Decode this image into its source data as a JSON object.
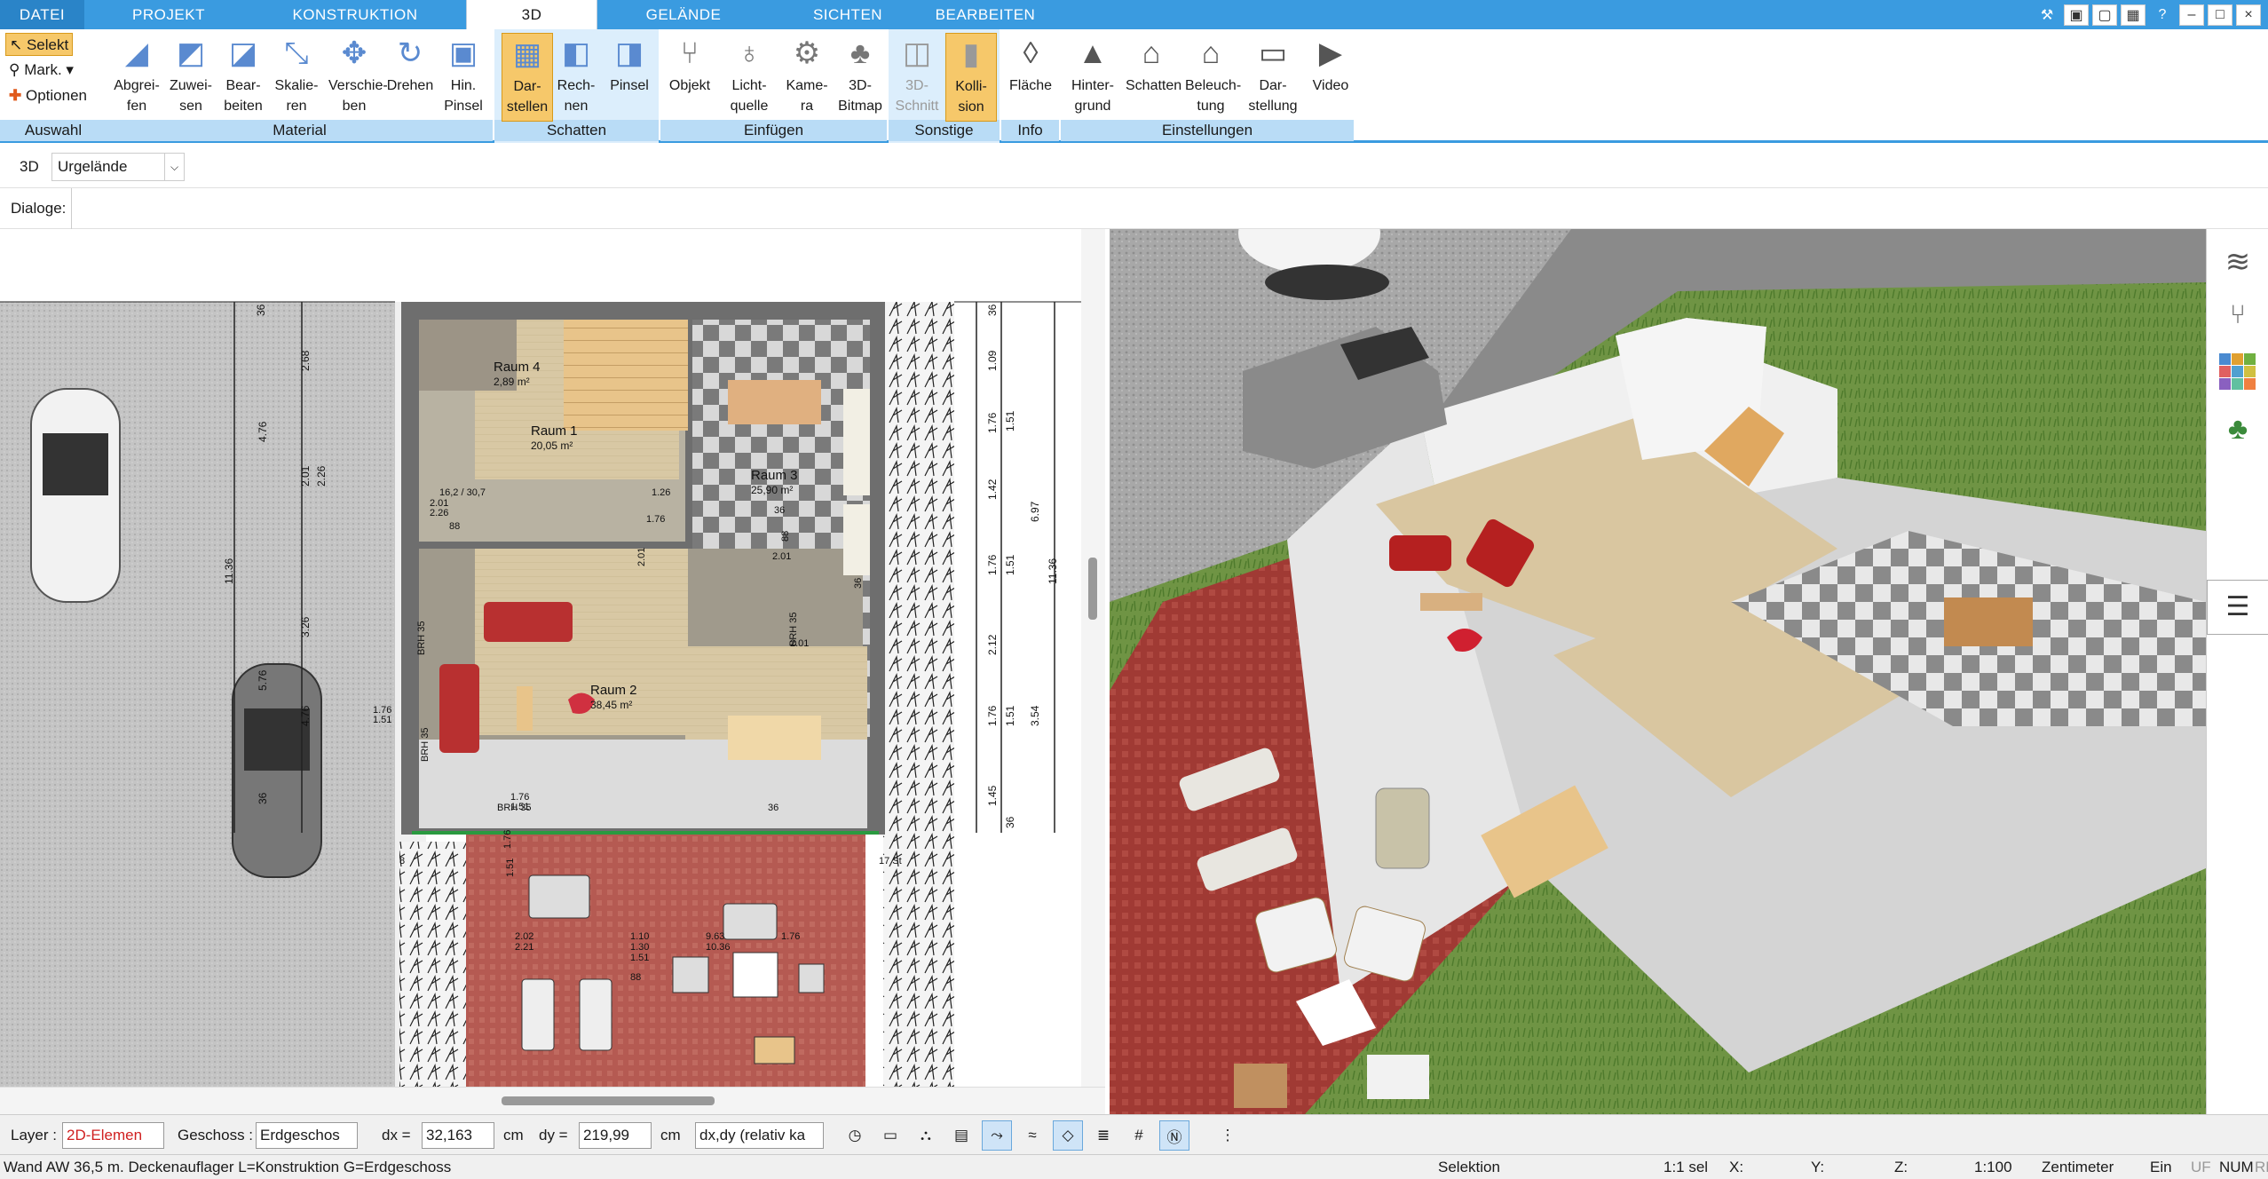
{
  "tabs": [
    "DATEI",
    "PROJEKT",
    "KONSTRUKTION",
    "3D",
    "GELÄNDE",
    "SICHTEN",
    "BEARBEITEN"
  ],
  "ribbon": {
    "auswahl": {
      "select": "Selekt",
      "mark": "Mark.",
      "options": "Optionen",
      "label": "Auswahl"
    },
    "material": {
      "label": "Material",
      "buttons": [
        "Abgrei-fen",
        "Zuwei-sen",
        "Bear-beiten",
        "Skalie-ren",
        "Verschie-ben",
        "Drehen",
        "Hin. Pinsel"
      ]
    },
    "schatten": {
      "label": "Schatten",
      "buttons": [
        "Dar-stellen",
        "Rech-nen",
        "Pinsel"
      ]
    },
    "einfuegen": {
      "label": "Einfügen",
      "buttons": [
        "Objekt",
        "Licht-quelle",
        "Kame-ra",
        "3D-Bitmap"
      ]
    },
    "sonstige": {
      "label": "Sonstige",
      "buttons": [
        "3D-Schnitt",
        "Kolli-sion"
      ]
    },
    "info": {
      "label": "Info",
      "buttons": [
        "Fläche"
      ]
    },
    "einstellungen": {
      "label": "Einstellungen",
      "buttons": [
        "Hinter-grund",
        "Schatten",
        "Beleuch-tung",
        "Dar-stellung",
        "Video"
      ]
    }
  },
  "subtoolbar": {
    "mode": "3D",
    "terrain": "Urgelände",
    "dialoge": "Dialoge:"
  },
  "plan": {
    "rooms": [
      {
        "name": "Raum 4",
        "area": "2,89 m²"
      },
      {
        "name": "Raum 1",
        "area": "20,05 m²"
      },
      {
        "name": "Raum 3",
        "area": "25,90 m²"
      },
      {
        "name": "Raum 2",
        "area": "38,45 m²"
      }
    ],
    "dims_right": [
      "36",
      "1.09",
      "1.76",
      "1.51",
      "1.42",
      "6.97",
      "1.76",
      "1.51",
      "11.36",
      "2.12",
      "1.76",
      "1.51",
      "3.54",
      "1.45",
      "36"
    ],
    "dims_left": [
      "36",
      "2.68",
      "4.76",
      "2.01",
      "2.26",
      "11.36",
      "3.26",
      "5.76",
      "4.76",
      "36"
    ],
    "dims_misc": [
      "1.76",
      "1.51",
      "2.01",
      "2.26",
      "88",
      "2.01",
      "BRH 35",
      "1.76",
      "1.51",
      "1.76",
      "1.51",
      "2.02",
      "2.21",
      "1.10",
      "1.30",
      "9.63",
      "10.36",
      "1.76",
      "1.51",
      "88",
      "2.01",
      "88",
      "2.01",
      "BRH 35",
      "BRH 35",
      "BRH 35",
      "36",
      "36",
      "8",
      "17 St",
      "16,2 / 30,7",
      "1.26",
      "1.76",
      "36"
    ]
  },
  "bottom": {
    "layer_label": "Layer :",
    "layer_value": "2D-Elemen",
    "floor_label": "Geschoss :",
    "floor_value": "Erdgeschos",
    "dx_label": "dx =",
    "dx_value": "32,163",
    "dx_unit": "cm",
    "dy_label": "dy =",
    "dy_value": "219,99",
    "dy_unit": "cm",
    "mode_value": "dx,dy (relativ ka"
  },
  "status": {
    "info": "Wand AW 36,5 m. Deckenauflager L=Konstruktion G=Erdgeschoss",
    "mode": "Selektion",
    "sel": "1:1 sel",
    "x": "X:",
    "y": "Y:",
    "z": "Z:",
    "scale": "1:100",
    "unit": "Zentimeter",
    "ein": "Ein",
    "uf": "UF",
    "num": "NUM",
    "rf": "RF"
  },
  "colors": {
    "accent": "#3a9be0",
    "ribbon_group": "#b9dcf6",
    "selected": "#f6c86a"
  }
}
